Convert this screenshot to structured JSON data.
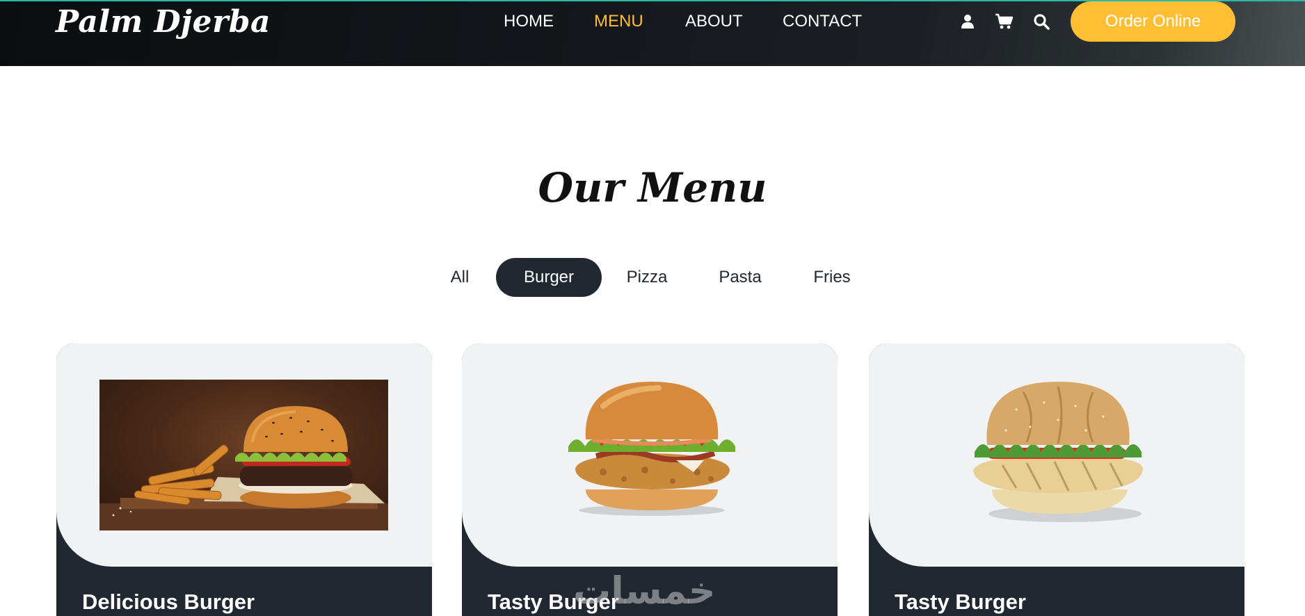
{
  "header": {
    "logo": "Palm Djerba",
    "nav": [
      {
        "label": "HOME",
        "active": false
      },
      {
        "label": "MENU",
        "active": true
      },
      {
        "label": "ABOUT",
        "active": false
      },
      {
        "label": "CONTACT",
        "active": false
      }
    ],
    "icons": [
      "user-icon",
      "cart-icon",
      "search-icon"
    ],
    "order_label": "Order Online"
  },
  "menu": {
    "title": "Our Menu",
    "filters": [
      {
        "label": "All",
        "active": false
      },
      {
        "label": "Burger",
        "active": true
      },
      {
        "label": "Pizza",
        "active": false
      },
      {
        "label": "Pasta",
        "active": false
      },
      {
        "label": "Fries",
        "active": false
      }
    ],
    "items": [
      {
        "title": "Delicious Burger",
        "image": "burger-photo-on-wooden-board"
      },
      {
        "title": "Tasty Burger",
        "image": "crispy-chicken-burger"
      },
      {
        "title": "Tasty Burger",
        "image": "grilled-chicken-burger"
      }
    ]
  },
  "watermark": "خمسات",
  "colors": {
    "accent": "#ffbe33",
    "dark": "#222831",
    "card_bg": "#f1f2f3",
    "header_bg": "#0b0d10"
  }
}
